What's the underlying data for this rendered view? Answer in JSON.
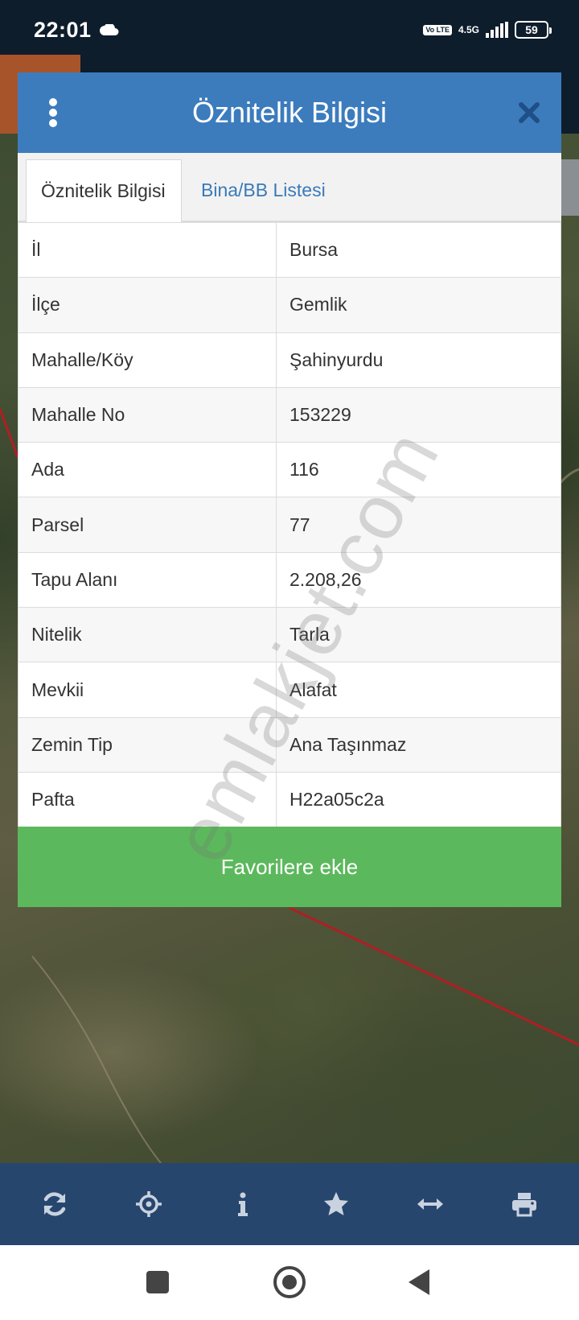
{
  "status_bar": {
    "time": "22:01",
    "volte_label": "Vo LTE",
    "network_label": "4.5G",
    "battery_level": "59"
  },
  "dialog": {
    "title": "Öznitelik Bilgisi",
    "tabs": [
      {
        "label": "Öznitelik Bilgisi",
        "active": true
      },
      {
        "label": "Bina/BB Listesi",
        "active": false
      }
    ],
    "rows": [
      {
        "key": "İl",
        "value": "Bursa"
      },
      {
        "key": "İlçe",
        "value": "Gemlik"
      },
      {
        "key": "Mahalle/Köy",
        "value": "Şahinyurdu"
      },
      {
        "key": "Mahalle No",
        "value": "153229"
      },
      {
        "key": "Ada",
        "value": "116"
      },
      {
        "key": "Parsel",
        "value": "77"
      },
      {
        "key": "Tapu Alanı",
        "value": "2.208,26"
      },
      {
        "key": "Nitelik",
        "value": "Tarla"
      },
      {
        "key": "Mevkii",
        "value": "Alafat"
      },
      {
        "key": "Zemin Tip",
        "value": "Ana Taşınmaz"
      },
      {
        "key": "Pafta",
        "value": "H22a05c2a"
      }
    ],
    "favorite_button": "Favorilere ekle"
  },
  "watermark": "emlakjet.com",
  "toolbar": {
    "icons": [
      "refresh-icon",
      "crosshair-icon",
      "info-icon",
      "star-icon",
      "measure-icon",
      "print-icon"
    ]
  },
  "colors": {
    "header": "#3c7cbd",
    "favorite_button": "#5cb85c",
    "toolbar": "#27466e"
  }
}
